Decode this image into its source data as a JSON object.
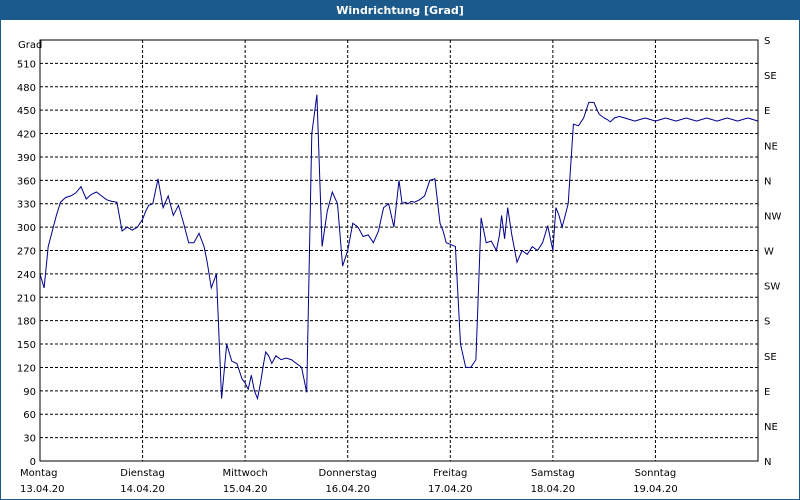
{
  "window": {
    "title": "Windrichtung [Grad]"
  },
  "colors": {
    "titlebar": "#1c5a8c",
    "line": "#00008b",
    "grid": "#000000"
  },
  "chart_data": {
    "type": "line",
    "title": "Windrichtung [Grad]",
    "ylabel": "Grad",
    "ylim": [
      0,
      540
    ],
    "yticks": [
      0,
      30,
      60,
      90,
      120,
      150,
      180,
      210,
      240,
      270,
      300,
      330,
      360,
      390,
      420,
      450,
      480,
      510
    ],
    "y2ticks": [
      "N",
      "NE",
      "E",
      "SE",
      "S",
      "SW",
      "W",
      "NW",
      "N",
      "NE",
      "E",
      "SE",
      "S"
    ],
    "grid": true,
    "xlim": [
      0,
      7
    ],
    "xticks": [
      {
        "day": "Montag",
        "date": "13.04.20"
      },
      {
        "day": "Dienstag",
        "date": "14.04.20"
      },
      {
        "day": "Mittwoch",
        "date": "15.04.20"
      },
      {
        "day": "Donnerstag",
        "date": "16.04.20"
      },
      {
        "day": "Freitag",
        "date": "17.04.20"
      },
      {
        "day": "Samstag",
        "date": "18.04.20"
      },
      {
        "day": "Sonntag",
        "date": "19.04.20"
      }
    ],
    "series": [
      {
        "x": [
          0,
          0.04,
          0.08,
          0.12,
          0.16,
          0.2,
          0.25,
          0.3,
          0.35,
          0.4,
          0.45,
          0.5,
          0.55,
          0.6,
          0.65,
          0.7,
          0.75,
          0.8,
          0.85,
          0.9,
          0.95,
          1.0,
          1.03,
          1.06,
          1.1,
          1.15,
          1.2,
          1.25,
          1.3,
          1.35,
          1.4,
          1.45,
          1.5,
          1.55,
          1.6,
          1.63,
          1.67,
          1.72,
          1.77,
          1.82,
          1.87,
          1.92,
          1.97,
          2.0,
          2.03,
          2.06,
          2.09,
          2.12,
          2.15,
          2.18,
          2.2,
          2.23,
          2.26,
          2.3,
          2.35,
          2.4,
          2.45,
          2.5,
          2.55,
          2.6,
          2.65,
          2.7,
          2.75,
          2.8,
          2.85,
          2.9,
          2.95,
          3.0,
          3.05,
          3.1,
          3.15,
          3.2,
          3.25,
          3.3,
          3.35,
          3.4,
          3.45,
          3.5,
          3.53,
          3.56,
          3.59,
          3.62,
          3.65,
          3.7,
          3.75,
          3.8,
          3.85,
          3.9,
          3.93,
          3.96,
          4.0,
          4.05,
          4.1,
          4.15,
          4.2,
          4.25,
          4.3,
          4.35,
          4.4,
          4.45,
          4.48,
          4.5,
          4.53,
          4.56,
          4.6,
          4.65,
          4.7,
          4.75,
          4.8,
          4.85,
          4.9,
          4.95,
          5.0,
          5.03,
          5.06,
          5.09,
          5.12,
          5.15,
          5.2,
          5.25,
          5.3,
          5.35,
          5.4,
          5.45,
          5.5,
          5.53,
          5.56,
          5.6,
          5.65,
          5.7,
          5.75,
          5.8,
          5.85,
          5.9,
          5.95,
          6.0,
          6.05,
          6.1,
          6.15,
          6.2,
          6.25,
          6.3,
          6.35,
          6.4,
          6.45,
          6.5,
          6.55,
          6.6,
          6.65,
          6.7,
          6.75,
          6.8,
          6.85,
          6.9,
          6.95,
          7.0
        ],
        "y": [
          240,
          222,
          275,
          295,
          315,
          332,
          338,
          340,
          344,
          352,
          336,
          342,
          345,
          340,
          335,
          333,
          332,
          295,
          300,
          296,
          300,
          310,
          320,
          328,
          330,
          362,
          325,
          340,
          315,
          328,
          305,
          280,
          280,
          292,
          275,
          255,
          222,
          240,
          80,
          150,
          128,
          125,
          105,
          100,
          92,
          110,
          90,
          80,
          100,
          125,
          140,
          135,
          125,
          135,
          130,
          132,
          130,
          125,
          120,
          88,
          420,
          470,
          275,
          320,
          345,
          330,
          250,
          270,
          305,
          300,
          288,
          290,
          280,
          295,
          325,
          330,
          300,
          360,
          330,
          332,
          330,
          333,
          332,
          335,
          340,
          360,
          362,
          305,
          295,
          280,
          278,
          275,
          150,
          120,
          120,
          130,
          312,
          280,
          282,
          270,
          290,
          315,
          285,
          325,
          290,
          255,
          270,
          265,
          275,
          270,
          280,
          302,
          270,
          325,
          315,
          300,
          315,
          330,
          432,
          430,
          440,
          460,
          460,
          445,
          440,
          438,
          435,
          440,
          442,
          440,
          438,
          436,
          438,
          440,
          438,
          436,
          438,
          440,
          438,
          436,
          438,
          440,
          438,
          436,
          438,
          440,
          438,
          436,
          438,
          440,
          438,
          436,
          438,
          440,
          438,
          436
        ]
      }
    ]
  }
}
